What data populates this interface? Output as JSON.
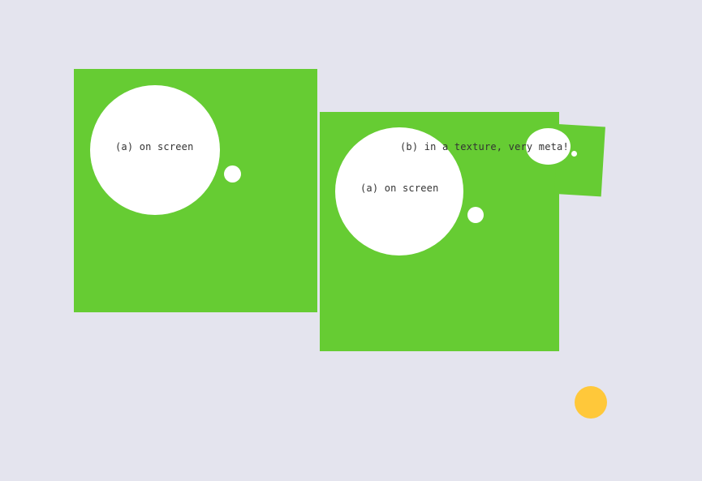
{
  "colors": {
    "background": "#e4e4ee",
    "panel": "#66cc33",
    "bubble": "#ffffff",
    "text": "#333333",
    "sun": "#ffc83a"
  },
  "labels": {
    "screen_a": "(a) on screen",
    "texture_a": "(a) on screen",
    "texture_b": "(b) in a texture, very meta!"
  },
  "icons": {
    "sun": "yellow-circle-icon"
  }
}
